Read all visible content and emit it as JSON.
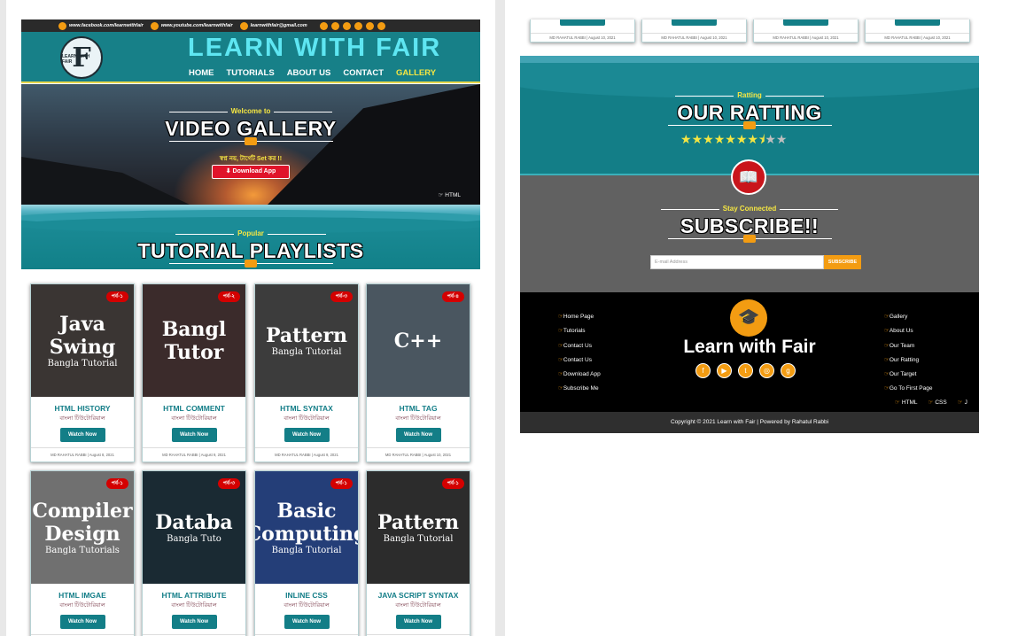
{
  "topbar": {
    "facebook": "www.facebook.com/learnwithfair",
    "youtube": "www.youtube.com/learnwithfair",
    "email": "learnwithfair@gmail.com"
  },
  "header": {
    "logo_letter": "F",
    "logo_text": "LEARN WITH FAIR",
    "brand": "LEARN WITH FAIR",
    "nav": [
      "HOME",
      "TUTORIALS",
      "ABOUT US",
      "CONTACT",
      "GALLERY"
    ],
    "active_nav": "GALLERY"
  },
  "hero": {
    "kicker": "Welcome to",
    "title": "VIDEO GALLERY",
    "tagline": "স্বপ্ন নয়, টার্গেট Set কর !!",
    "download_label": "Download App",
    "marquee": "HTML"
  },
  "playlists": {
    "kicker": "Popular",
    "title": "TUTORIAL PLAYLISTS"
  },
  "cards": [
    {
      "part": "পর্ব-১",
      "thumb": "Java Swing",
      "thumb_sub": "Bangla Tutorial",
      "title": "HTML HISTORY",
      "subtitle": "বাংলা টিউটোরিয়াল",
      "watch": "Watch Now",
      "meta": "MD RAHATUL RABBI  |  August 8, 2021",
      "bg": "#3a3533"
    },
    {
      "part": "পর্ব-২",
      "thumb": "Bangl Tutor",
      "thumb_sub": "",
      "title": "HTML COMMENT",
      "subtitle": "বাংলা টিউটোরিয়াল",
      "watch": "Watch Now",
      "meta": "MD RAHATUL RABBI  |  August 9, 2021",
      "bg": "#3b2b2b"
    },
    {
      "part": "পর্ব-৩",
      "thumb": "Pattern",
      "thumb_sub": "Bangla Tutorial",
      "title": "HTML SYNTAX",
      "subtitle": "বাংলা টিউটোরিয়াল",
      "watch": "Watch Now",
      "meta": "MD RAHATUL RABBI  |  August 9, 2021",
      "bg": "#3c3c3c"
    },
    {
      "part": "পর্ব-৪",
      "thumb": "C++",
      "thumb_sub": "",
      "title": "HTML TAG",
      "subtitle": "বাংলা টিউটোরিয়াল",
      "watch": "Watch Now",
      "meta": "MD RAHATUL RABBI  |  August 10, 2021",
      "bg": "#4a5660"
    },
    {
      "part": "পর্ব-১",
      "thumb": "Compiler Design",
      "thumb_sub": "Bangla Tutorials",
      "title": "HTML IMGAE",
      "subtitle": "বাংলা টিউটোরিয়াল",
      "watch": "Watch Now",
      "meta": "",
      "bg": "#707070"
    },
    {
      "part": "পর্ব-৩",
      "thumb": "Databa",
      "thumb_sub": "Bangla Tuto",
      "title": "HTML ATTRIBUTE",
      "subtitle": "বাংলা টিউটোরিয়াল",
      "watch": "Watch Now",
      "meta": "",
      "bg": "#1a2a33"
    },
    {
      "part": "পর্ব-১",
      "thumb": "Basic Computing",
      "thumb_sub": "Bangla Tutorial",
      "title": "INLINE CSS",
      "subtitle": "বাংলা টিউটোরিয়াল",
      "watch": "Watch Now",
      "meta": "",
      "bg": "#243e78"
    },
    {
      "part": "পর্ব-১",
      "thumb": "Pattern",
      "thumb_sub": "Bangla Tutorial",
      "title": "JAVA SCRIPT SYNTAX",
      "subtitle": "বাংলা টিউটোরিয়াল",
      "watch": "Watch Now",
      "meta": "",
      "bg": "#2c2c2c"
    }
  ],
  "top_cards_meta": [
    "MD RAHATUL RABBI  |  August 10, 2021",
    "MD RAHATUL RABBI  |  August 10, 2021",
    "MD RAHATUL RABBI  |  August 10, 2021",
    "MD RAHATUL RABBI  |  August 10, 2021"
  ],
  "rating": {
    "kicker": "Ratting",
    "title": "OUR RATTING",
    "stars": 7.5,
    "max_stars": 10
  },
  "subscribe": {
    "kicker": "Stay Connected",
    "title": "SUBSCRIBE!!",
    "placeholder": "E-mail Address",
    "button": "SUBSCRIBE"
  },
  "footer": {
    "left_links": [
      "Home Page",
      "Tutorials",
      "Contact Us",
      "Contact Us",
      "Download App",
      "Subscribe Me"
    ],
    "right_links": [
      "Gallery",
      "About Us",
      "Our Team",
      "Our Ratting",
      "Our Target",
      "Go To First Page"
    ],
    "brand": "Learn with Fair",
    "marquee": [
      "HTML",
      "CSS",
      "J"
    ],
    "copyright": "Copyright © 2021 Learn with Fair | Powered by Rahatul Rabbi"
  },
  "colors": {
    "teal": "#178088",
    "accent": "#f39c12",
    "yellow": "#f5e642",
    "red": "#e0142a"
  },
  "icons": {
    "hero_icon": "download-icon",
    "book": "book-icon",
    "cap": "graduation-cap-icon"
  }
}
